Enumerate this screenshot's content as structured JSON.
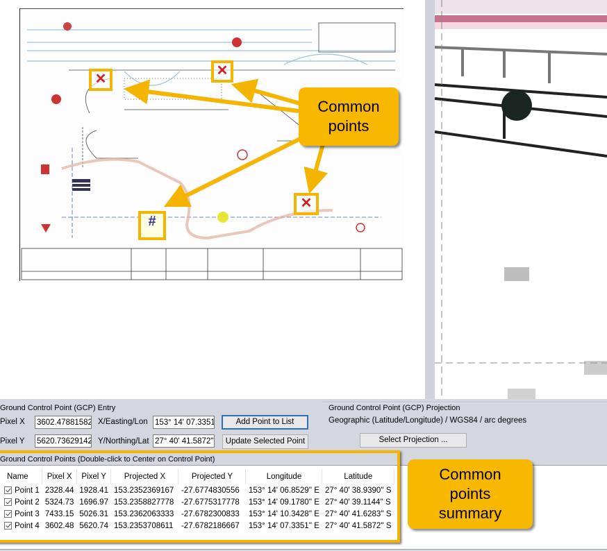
{
  "map_view": {
    "description": "Road plan drawing with ground control point markers",
    "callout_top": "Common points"
  },
  "gcp_entry": {
    "group_title": "Ground Control Point (GCP) Entry",
    "pixel_x_label": "Pixel X",
    "pixel_x_value": "3602.47881582",
    "pixel_y_label": "Pixel Y",
    "pixel_y_value": "5620.73629142",
    "x_label": "X/Easting/Lon",
    "x_value": "153° 14' 07.3351'",
    "y_label": "Y/Northing/Lat",
    "y_value": "27° 40' 41.5872\"",
    "add_button": "Add Point to List",
    "update_button": "Update Selected Point"
  },
  "gcp_projection": {
    "group_title": "Ground Control Point (GCP) Projection",
    "projection": "Geographic (Latitude/Longitude) / WGS84 / arc degrees",
    "select_button": "Select Projection ..."
  },
  "gcp_list": {
    "group_title": "Ground Control Points (Double-click to Center on Control Point)",
    "columns": [
      "Name",
      "Pixel X",
      "Pixel Y",
      "Projected X",
      "Projected Y",
      "Longitude",
      "Latitude"
    ],
    "rows": [
      {
        "checked": true,
        "name": "Point 1",
        "pixel_x": "2328.44",
        "pixel_y": "1928.41",
        "proj_x": "153.2352369167",
        "proj_y": "-27.6774830556",
        "lon": "153° 14' 06.8529'' E",
        "lat": "27° 40' 38.9390'' S"
      },
      {
        "checked": true,
        "name": "Point 2",
        "pixel_x": "5324.73",
        "pixel_y": "1696.97",
        "proj_x": "153.2358827778",
        "proj_y": "-27.6775317778",
        "lon": "153° 14' 09.1780'' E",
        "lat": "27° 40' 39.1144'' S"
      },
      {
        "checked": true,
        "name": "Point 3",
        "pixel_x": "7433.15",
        "pixel_y": "5026.31",
        "proj_x": "153.2362063333",
        "proj_y": "-27.6782300833",
        "lon": "153° 14' 10.3428'' E",
        "lat": "27° 40' 41.6283'' S"
      },
      {
        "checked": true,
        "name": "Point 4",
        "pixel_x": "3602.48",
        "pixel_y": "5620.74",
        "proj_x": "153.2353708611",
        "proj_y": "-27.6782186667",
        "lon": "153° 14' 07.3351'' E",
        "lat": "27° 40' 41.5872'' S"
      }
    ]
  },
  "callout_bottom": "Common points summary",
  "colors": {
    "accent_callout": "#f8b800",
    "marker_x": "#d02020",
    "default_button_border": "#2e6fb6"
  }
}
